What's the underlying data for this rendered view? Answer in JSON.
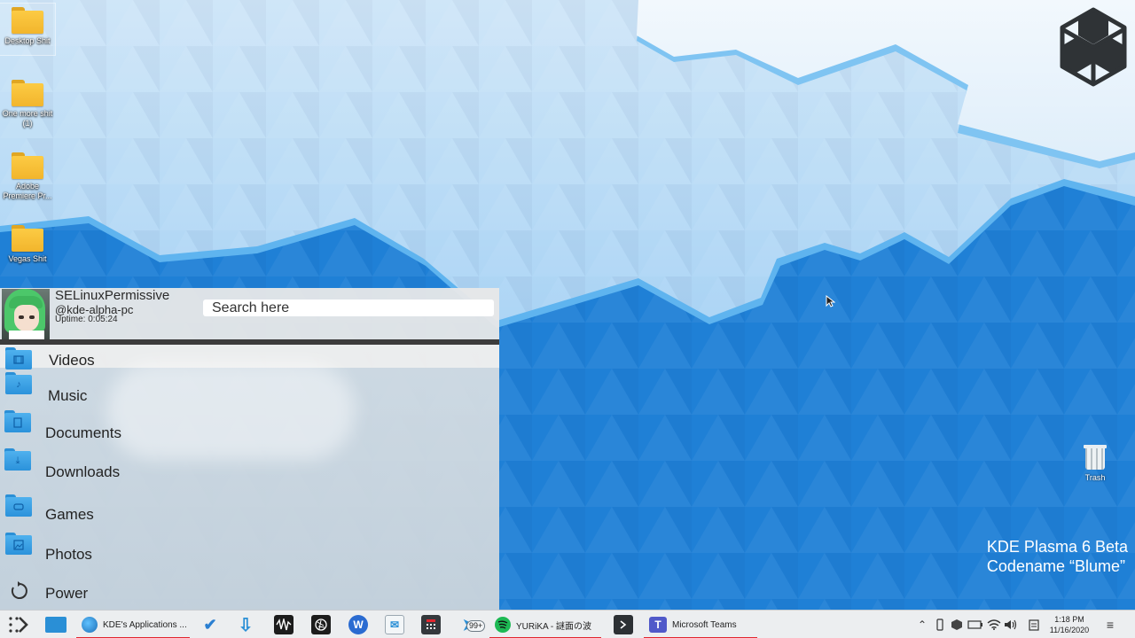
{
  "desktop": {
    "icons": [
      {
        "label": "Desktop Shit"
      },
      {
        "label": "One more shit (1)"
      },
      {
        "label": "Adobe Premiere Pr..."
      },
      {
        "label": "Vegas Shit"
      }
    ],
    "trash_label": "Trash",
    "watermark_line1": "KDE Plasma 6 Beta",
    "watermark_line2": "Codename “Blume”"
  },
  "launcher": {
    "username": "SELinuxPermissive",
    "hostname": "@kde-alpha-pc",
    "uptime": "Uptime: 0:05:24",
    "search_placeholder": "Search here",
    "items": [
      {
        "label": "Videos",
        "icon": "video-folder-icon"
      },
      {
        "label": "Music",
        "icon": "music-folder-icon"
      },
      {
        "label": "Documents",
        "icon": "documents-folder-icon"
      },
      {
        "label": "Downloads",
        "icon": "downloads-folder-icon"
      },
      {
        "label": "Games",
        "icon": "games-folder-icon"
      },
      {
        "label": "Photos",
        "icon": "photos-folder-icon"
      },
      {
        "label": "Power",
        "icon": "power-icon"
      }
    ]
  },
  "taskbar": {
    "tasks": [
      {
        "label": "KDE's Applications ...",
        "icon": "globe-icon"
      },
      {
        "label": "YURiKA - 謎面の波",
        "icon": "spotify-icon"
      },
      {
        "label": "Microsoft Teams",
        "icon": "teams-icon"
      }
    ],
    "telegram_badge": "99+",
    "clock_time": "1:18 PM",
    "clock_date": "11/16/2020",
    "colors": {
      "accent_underline": "#e2262f",
      "panel_bg": "#eceef0"
    }
  }
}
